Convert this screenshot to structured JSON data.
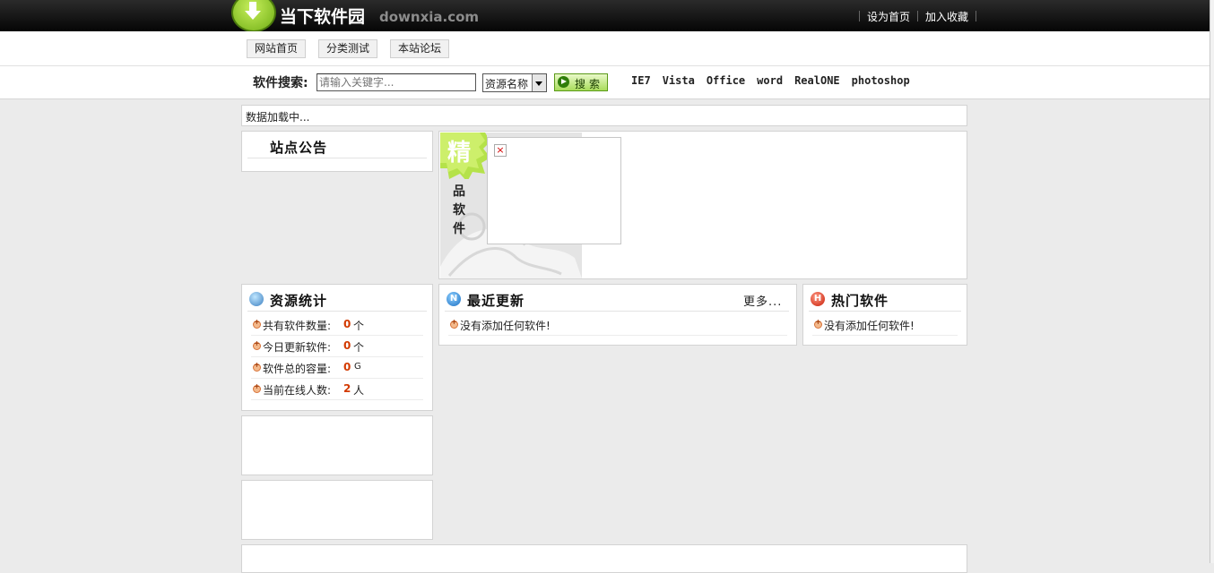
{
  "header": {
    "logo_cn": "当下软件园",
    "logo_en": "downxia.com",
    "links": [
      "设为首页",
      "加入收藏"
    ]
  },
  "nav": {
    "items": [
      "网站首页",
      "分类测试",
      "本站论坛"
    ]
  },
  "search": {
    "label": "软件搜索:",
    "placeholder": "请输入关键字...",
    "select_value": "资源名称",
    "button_label": "搜索",
    "hot_keywords": [
      "IE7",
      "Vista",
      "Office",
      "word",
      "RealONE",
      "photoshop"
    ]
  },
  "loading": "数据加载中...",
  "announcement": {
    "title": "站点公告"
  },
  "featured": {
    "badge": "精",
    "label_chars": [
      "品",
      "软",
      "件"
    ],
    "broken_image": "×"
  },
  "stats": {
    "title": "资源统计",
    "rows": [
      {
        "label": "共有软件数量:",
        "value": "0",
        "unit": "个"
      },
      {
        "label": "今日更新软件:",
        "value": "0",
        "unit": "个"
      },
      {
        "label": "软件总的容量:",
        "value": "0",
        "unit": "G"
      },
      {
        "label": "当前在线人数:",
        "value": "2",
        "unit": "人"
      }
    ]
  },
  "latest": {
    "title": "最近更新",
    "more": "更多...",
    "empty": "没有添加任何软件!"
  },
  "hot": {
    "title": "热门软件",
    "empty": "没有添加任何软件!"
  },
  "colors": {
    "accent_green": "#8cc63f",
    "number_red": "#d33a00",
    "topbar": "#0a0a0a"
  }
}
